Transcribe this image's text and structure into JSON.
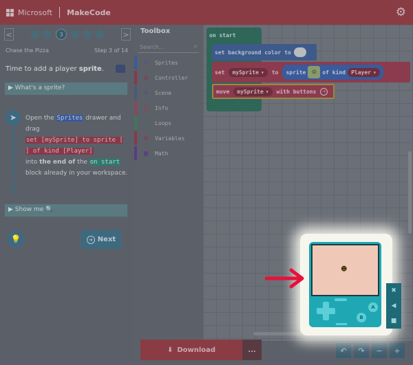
{
  "header": {
    "brand": "Microsoft",
    "app_name": "MakeCode"
  },
  "tutorial": {
    "step_number": "3",
    "title": "Chase the Pizza",
    "progress": "Step 3 of 14",
    "heading_prefix": "Time to add a player ",
    "heading_bold": "sprite",
    "heading_suffix": ".",
    "hint1": "What's a sprite?",
    "instruction": {
      "t1": "Open the ",
      "code1": "Sprites",
      "t2": " drawer and drag",
      "code2": "set [mySprite] to sprite [ ] of kind [Player]",
      "t3": "into ",
      "bold1": "the end of",
      "t4": " the ",
      "code3": "on start",
      "t5": " block already in your workspace."
    },
    "hint2": "Show me",
    "next_label": "Next"
  },
  "toolbox": {
    "title": "Toolbox",
    "search_placeholder": "Search...",
    "categories": [
      {
        "label": "Sprites",
        "color": "#3a5a9a",
        "icon": "paper-plane-icon"
      },
      {
        "label": "Controller",
        "color": "#8a3848",
        "icon": "gamepad-icon"
      },
      {
        "label": "Scene",
        "color": "#4a5a78",
        "icon": "tree-icon"
      },
      {
        "label": "Info",
        "color": "#8a4858",
        "icon": "id-card-icon"
      },
      {
        "label": "Loops",
        "color": "#3a7a5a",
        "icon": "refresh-icon"
      },
      {
        "label": "Variables",
        "color": "#8a3848",
        "icon": "list-icon"
      },
      {
        "label": "Math",
        "color": "#5a3a8a",
        "icon": "calculator-icon"
      }
    ]
  },
  "workspace": {
    "on_start": "on start",
    "bg_block": "set background color to",
    "set_block": {
      "set": "set",
      "variable": "mySprite",
      "to": "to",
      "sprite": "sprite",
      "of_kind": "of kind",
      "kind": "Player"
    },
    "move_block": {
      "move": "move",
      "variable": "mySprite",
      "with_buttons": "with buttons"
    }
  },
  "footer": {
    "download_label": "Download",
    "more_label": "..."
  },
  "simulator": {
    "a_label": "A",
    "b_label": "B"
  },
  "colors": {
    "accent": "#8a3c45",
    "arrow": "#e8103a",
    "simulator_body": "#1fa8b4",
    "screen": "#f0c8b8"
  }
}
